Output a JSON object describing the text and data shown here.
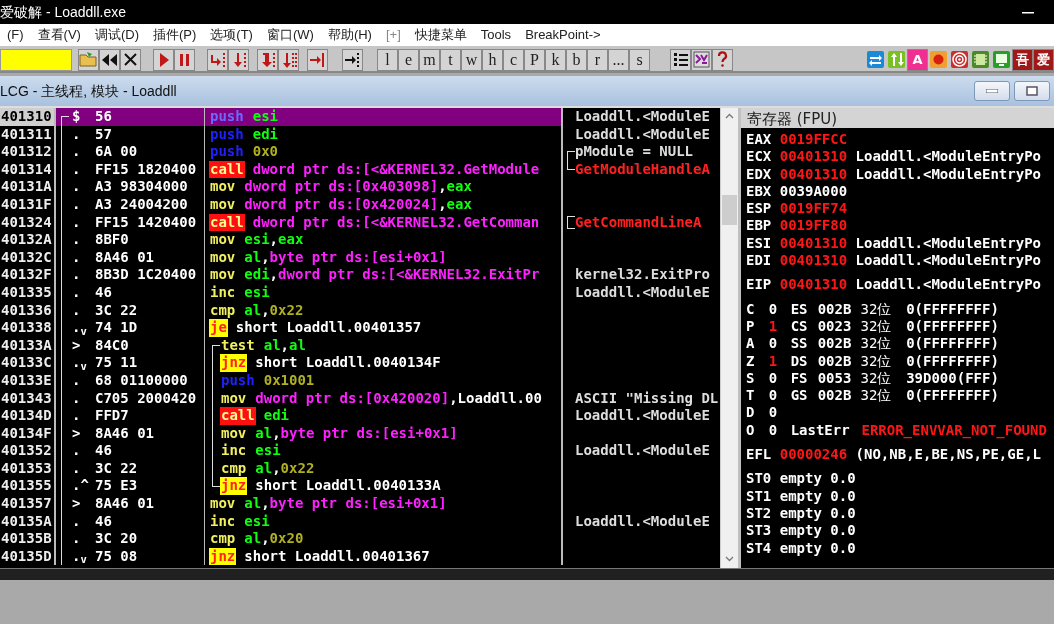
{
  "window": {
    "title": "爱破解 - Loaddll.exe"
  },
  "menu": [
    "(F)",
    "查看(V)",
    "调试(D)",
    "插件(P)",
    "选项(T)",
    "窗口(W)",
    "帮助(H)",
    "[+]",
    "快捷菜单",
    "Tools",
    "BreakPoint->"
  ],
  "toolbar": {
    "letter_buttons": [
      "l",
      "e",
      "m",
      "t",
      "w",
      "h",
      "c",
      "P",
      "k",
      "b",
      "r",
      "...",
      "s"
    ],
    "plugin_buttons": [
      {
        "kind": "icon"
      },
      {
        "kind": "icon"
      },
      {
        "kind": "text",
        "label": "A"
      },
      {
        "kind": "icon"
      },
      {
        "kind": "icon"
      },
      {
        "kind": "icon"
      },
      {
        "kind": "icon"
      },
      {
        "kind": "text",
        "label": "吾"
      },
      {
        "kind": "text",
        "label": "爱"
      }
    ]
  },
  "child_window": {
    "title": "LCG -  主线程, 模块 - Loaddll"
  },
  "disassembly": {
    "rows": [
      {
        "address": "401310",
        "mark": "$",
        "hex": "56",
        "mnemonic": "push",
        "kind": "push",
        "operands": [
          {
            "t": "esi",
            "kind": "reg"
          }
        ],
        "comment": {
          "text": "Loaddll.<ModuleE",
          "kind": "note"
        },
        "proc_bracket": {
          "kind": "start"
        },
        "selected": true
      },
      {
        "address": "401311",
        "mark": ".",
        "hex": "57",
        "mnemonic": "push",
        "kind": "push",
        "operands": [
          {
            "t": "edi",
            "kind": "reg"
          }
        ],
        "comment": {
          "text": "Loaddll.<ModuleE",
          "kind": "note"
        },
        "proc_bracket": {
          "kind": "body"
        },
        "selected": false
      },
      {
        "address": "401312",
        "mark": ".",
        "hex": "6A 00",
        "mnemonic": "push",
        "kind": "push",
        "operands": [
          {
            "t": "0x0",
            "kind": "num"
          }
        ],
        "comment": {
          "text": "pModule = NULL",
          "kind": "note",
          "bracket": {
            "kind": "top"
          }
        },
        "proc_bracket": {
          "kind": "body"
        },
        "selected": false
      },
      {
        "address": "401314",
        "mark": ".",
        "hex": "FF15 1820400",
        "mnemonic": "call",
        "kind": "call",
        "operands": [
          {
            "t": "dword ptr ds:[<&KERNEL32.GetModule",
            "kind": "mem"
          }
        ],
        "comment": {
          "text": "GetModuleHandleA",
          "kind": "api",
          "bracket": {
            "kind": "bottom"
          }
        },
        "proc_bracket": {
          "kind": "body"
        },
        "selected": false
      },
      {
        "address": "40131A",
        "mark": ".",
        "hex": "A3 98304000",
        "mnemonic": "mov",
        "kind": "plain",
        "operands": [
          {
            "t": "dword ptr ds:[0x403098]",
            "kind": "mem"
          },
          {
            "t": ",",
            "kind": "sym"
          },
          {
            "t": "eax",
            "kind": "reg"
          }
        ],
        "proc_bracket": {
          "kind": "body"
        },
        "selected": false
      },
      {
        "address": "40131F",
        "mark": ".",
        "hex": "A3 24004200",
        "mnemonic": "mov",
        "kind": "plain",
        "operands": [
          {
            "t": "dword ptr ds:[0x420024]",
            "kind": "mem"
          },
          {
            "t": ",",
            "kind": "sym"
          },
          {
            "t": "eax",
            "kind": "reg"
          }
        ],
        "proc_bracket": {
          "kind": "body"
        },
        "selected": false
      },
      {
        "address": "401324",
        "mark": ".",
        "hex": "FF15 1420400",
        "mnemonic": "call",
        "kind": "call",
        "operands": [
          {
            "t": "dword ptr ds:[<&KERNEL32.GetComman",
            "kind": "mem"
          }
        ],
        "comment": {
          "text": "GetCommandLineA",
          "kind": "api",
          "bracket": {
            "kind": "single"
          }
        },
        "proc_bracket": {
          "kind": "body"
        },
        "selected": false
      },
      {
        "address": "40132A",
        "mark": ".",
        "hex": "8BF0",
        "mnemonic": "mov",
        "kind": "plain",
        "operands": [
          {
            "t": "esi",
            "kind": "reg"
          },
          {
            "t": ",",
            "kind": "sym"
          },
          {
            "t": "eax",
            "kind": "reg"
          }
        ],
        "proc_bracket": {
          "kind": "body"
        },
        "selected": false
      },
      {
        "address": "40132C",
        "mark": ".",
        "hex": "8A46 01",
        "mnemonic": "mov",
        "kind": "plain",
        "operands": [
          {
            "t": "al",
            "kind": "reg"
          },
          {
            "t": ",",
            "kind": "sym"
          },
          {
            "t": "byte ptr ds:[esi+0x1]",
            "kind": "mem"
          }
        ],
        "proc_bracket": {
          "kind": "body"
        },
        "selected": false
      },
      {
        "address": "40132F",
        "mark": ".",
        "hex": "8B3D 1C20400",
        "mnemonic": "mov",
        "kind": "plain",
        "operands": [
          {
            "t": "edi",
            "kind": "reg"
          },
          {
            "t": ",",
            "kind": "sym"
          },
          {
            "t": "dword ptr ds:[<&KERNEL32.ExitPr",
            "kind": "mem"
          }
        ],
        "comment": {
          "text": "kernel32.ExitPro",
          "kind": "note"
        },
        "proc_bracket": {
          "kind": "body"
        },
        "selected": false
      },
      {
        "address": "401335",
        "mark": ".",
        "hex": "46",
        "mnemonic": "inc",
        "kind": "plain",
        "operands": [
          {
            "t": "esi",
            "kind": "reg"
          }
        ],
        "comment": {
          "text": "Loaddll.<ModuleE",
          "kind": "note"
        },
        "proc_bracket": {
          "kind": "body"
        },
        "selected": false
      },
      {
        "address": "401336",
        "mark": ".",
        "hex": "3C 22",
        "mnemonic": "cmp",
        "kind": "plain",
        "operands": [
          {
            "t": "al",
            "kind": "reg"
          },
          {
            "t": ",",
            "kind": "sym"
          },
          {
            "t": "0x22",
            "kind": "num"
          }
        ],
        "proc_bracket": {
          "kind": "body"
        },
        "selected": false
      },
      {
        "address": "401338",
        "mark": ".$_{v}$",
        "hex": "74 1D",
        "mnemonic": "je",
        "kind": "jump",
        "operands": [
          {
            "t": "short Loaddll.00401357",
            "kind": "sym"
          }
        ],
        "proc_bracket": {
          "kind": "body"
        },
        "selected": false
      },
      {
        "address": "40133A",
        "mark": ">",
        "hex": "84C0",
        "mnemonic": "test",
        "kind": "plain",
        "operands": [
          {
            "t": "al",
            "kind": "reg"
          },
          {
            "t": ",",
            "kind": "sym"
          },
          {
            "t": "al",
            "kind": "reg"
          }
        ],
        "proc_bracket": {
          "kind": "body"
        },
        "loop_bracket": {
          "kind": "top"
        },
        "selected": false
      },
      {
        "address": "40133C",
        "mark": ".$_{v}$",
        "hex": "75 11",
        "mnemonic": "jnz",
        "kind": "jump",
        "operands": [
          {
            "t": "short Loaddll.0040134F",
            "kind": "sym"
          }
        ],
        "proc_bracket": {
          "kind": "body"
        },
        "loop_bracket": {
          "kind": "inside"
        },
        "selected": false
      },
      {
        "address": "40133E",
        "mark": ".",
        "hex": "68 01100000",
        "mnemonic": "push",
        "kind": "push",
        "operands": [
          {
            "t": "0x1001",
            "kind": "num"
          }
        ],
        "proc_bracket": {
          "kind": "body"
        },
        "loop_bracket": {
          "kind": "inside"
        },
        "selected": false
      },
      {
        "address": "401343",
        "mark": ".",
        "hex": "C705 2000420",
        "mnemonic": "mov",
        "kind": "plain",
        "operands": [
          {
            "t": "dword ptr ds:[0x420020]",
            "kind": "mem"
          },
          {
            "t": ",",
            "kind": "sym"
          },
          {
            "t": "Loaddll.00",
            "kind": "sym"
          }
        ],
        "comment": {
          "text": "ASCII \"Missing DL",
          "kind": "note"
        },
        "proc_bracket": {
          "kind": "body"
        },
        "loop_bracket": {
          "kind": "inside"
        },
        "selected": false
      },
      {
        "address": "40134D",
        "mark": ".",
        "hex": "FFD7",
        "mnemonic": "call",
        "kind": "call",
        "operands": [
          {
            "t": "edi",
            "kind": "reg"
          }
        ],
        "comment": {
          "text": "Loaddll.<ModuleE",
          "kind": "note"
        },
        "proc_bracket": {
          "kind": "body"
        },
        "loop_bracket": {
          "kind": "inside"
        },
        "selected": false
      },
      {
        "address": "40134F",
        "mark": ">",
        "hex": "8A46 01",
        "mnemonic": "mov",
        "kind": "plain",
        "operands": [
          {
            "t": "al",
            "kind": "reg"
          },
          {
            "t": ",",
            "kind": "sym"
          },
          {
            "t": "byte ptr ds:[esi+0x1]",
            "kind": "mem"
          }
        ],
        "proc_bracket": {
          "kind": "body"
        },
        "loop_bracket": {
          "kind": "inside"
        },
        "selected": false
      },
      {
        "address": "401352",
        "mark": ".",
        "hex": "46",
        "mnemonic": "inc",
        "kind": "plain",
        "operands": [
          {
            "t": "esi",
            "kind": "reg"
          }
        ],
        "comment": {
          "text": "Loaddll.<ModuleE",
          "kind": "note"
        },
        "proc_bracket": {
          "kind": "body"
        },
        "loop_bracket": {
          "kind": "inside"
        },
        "selected": false
      },
      {
        "address": "401353",
        "mark": ".",
        "hex": "3C 22",
        "mnemonic": "cmp",
        "kind": "plain",
        "operands": [
          {
            "t": "al",
            "kind": "reg"
          },
          {
            "t": ",",
            "kind": "sym"
          },
          {
            "t": "0x22",
            "kind": "num"
          }
        ],
        "proc_bracket": {
          "kind": "body"
        },
        "loop_bracket": {
          "kind": "inside"
        },
        "selected": false
      },
      {
        "address": "401355",
        "mark": ".^",
        "hex": "75 E3",
        "mnemonic": "jnz",
        "kind": "jump",
        "operands": [
          {
            "t": "short Loaddll.0040133A",
            "kind": "sym"
          }
        ],
        "proc_bracket": {
          "kind": "body"
        },
        "loop_bracket": {
          "kind": "bottom"
        },
        "selected": false
      },
      {
        "address": "401357",
        "mark": ">",
        "hex": "8A46 01",
        "mnemonic": "mov",
        "kind": "plain",
        "operands": [
          {
            "t": "al",
            "kind": "reg"
          },
          {
            "t": ",",
            "kind": "sym"
          },
          {
            "t": "byte ptr ds:[esi+0x1]",
            "kind": "mem"
          }
        ],
        "proc_bracket": {
          "kind": "body"
        },
        "selected": false
      },
      {
        "address": "40135A",
        "mark": ".",
        "hex": "46",
        "mnemonic": "inc",
        "kind": "plain",
        "operands": [
          {
            "t": "esi",
            "kind": "reg"
          }
        ],
        "comment": {
          "text": "Loaddll.<ModuleE",
          "kind": "note"
        },
        "proc_bracket": {
          "kind": "body"
        },
        "selected": false
      },
      {
        "address": "40135B",
        "mark": ".",
        "hex": "3C 20",
        "mnemonic": "cmp",
        "kind": "plain",
        "operands": [
          {
            "t": "al",
            "kind": "reg"
          },
          {
            "t": ",",
            "kind": "sym"
          },
          {
            "t": "0x20",
            "kind": "num"
          }
        ],
        "proc_bracket": {
          "kind": "body"
        },
        "selected": false
      },
      {
        "address": "40135D",
        "mark": ".$_{v}$",
        "hex": "75 08",
        "mnemonic": "jnz",
        "kind": "jump",
        "operands": [
          {
            "t": "short Loaddll.00401367",
            "kind": "sym"
          }
        ],
        "proc_bracket": {
          "kind": "body"
        },
        "selected": false
      }
    ]
  },
  "registers": {
    "title": "寄存器 (FPU)",
    "general": [
      {
        "name": "EAX",
        "value": "0019FFCC",
        "changed": true
      },
      {
        "name": "ECX",
        "value": "00401310",
        "changed": true,
        "comment": "Loaddll.<ModuleEntryPo"
      },
      {
        "name": "EDX",
        "value": "00401310",
        "changed": true,
        "comment": "Loaddll.<ModuleEntryPo"
      },
      {
        "name": "EBX",
        "value": "0039A000",
        "changed": false
      },
      {
        "name": "ESP",
        "value": "0019FF74",
        "changed": true
      },
      {
        "name": "EBP",
        "value": "0019FF80",
        "changed": true
      },
      {
        "name": "ESI",
        "value": "00401310",
        "changed": true,
        "comment": "Loaddll.<ModuleEntryPo"
      },
      {
        "name": "EDI",
        "value": "00401310",
        "changed": true,
        "comment": "Loaddll.<ModuleEntryPo"
      }
    ],
    "eip": {
      "name": "EIP",
      "value": "00401310",
      "changed": true,
      "comment": "Loaddll.<ModuleEntryPo"
    },
    "flags": [
      {
        "name": "C",
        "value": "0",
        "changed": false,
        "segment": {
          "name": "ES",
          "value": "002B",
          "bits": "32位",
          "base": "0(FFFFFFFF)"
        }
      },
      {
        "name": "P",
        "value": "1",
        "changed": true,
        "segment": {
          "name": "CS",
          "value": "0023",
          "bits": "32位",
          "base": "0(FFFFFFFF)"
        }
      },
      {
        "name": "A",
        "value": "0",
        "changed": false,
        "segment": {
          "name": "SS",
          "value": "002B",
          "bits": "32位",
          "base": "0(FFFFFFFF)"
        }
      },
      {
        "name": "Z",
        "value": "1",
        "changed": true,
        "segment": {
          "name": "DS",
          "value": "002B",
          "bits": "32位",
          "base": "0(FFFFFFFF)"
        }
      },
      {
        "name": "S",
        "value": "0",
        "changed": false,
        "segment": {
          "name": "FS",
          "value": "0053",
          "bits": "32位",
          "base": "39D000(FFF)"
        }
      },
      {
        "name": "T",
        "value": "0",
        "changed": false,
        "segment": {
          "name": "GS",
          "value": "002B",
          "bits": "32位",
          "base": "0(FFFFFFFF)"
        }
      },
      {
        "name": "D",
        "value": "0",
        "changed": false
      },
      {
        "name": "O",
        "value": "0",
        "changed": false,
        "last_error": {
          "label": "LastErr",
          "value": "ERROR_ENVVAR_NOT_FOUND"
        }
      }
    ],
    "efl": {
      "name": "EFL",
      "value": "00000246",
      "changed": true,
      "comment": "(NO,NB,E,BE,NS,PE,GE,L"
    },
    "fpu": [
      {
        "name": "ST0",
        "tag": "empty",
        "value": "0.0"
      },
      {
        "name": "ST1",
        "tag": "empty",
        "value": "0.0"
      },
      {
        "name": "ST2",
        "tag": "empty",
        "value": "0.0"
      },
      {
        "name": "ST3",
        "tag": "empty",
        "value": "0.0"
      },
      {
        "name": "ST4",
        "tag": "empty",
        "value": "0.0"
      }
    ]
  }
}
